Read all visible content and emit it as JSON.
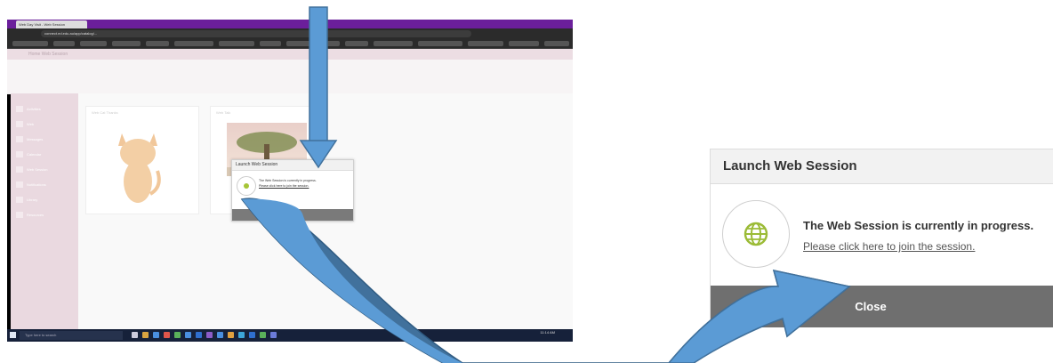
{
  "small_screenshot": {
    "browser_tab": "Web Day Visit - Web Session",
    "url": "connect.ed.edu.au/app/catalog/...",
    "app_bar": "Home    Web Session",
    "nav_items": [
      "Activities",
      "Web",
      "Messages",
      "Calendar",
      "Web Session",
      "Notifications",
      "Library",
      "Resources"
    ],
    "card1_label": "Web Cat Thanks",
    "card2_label": "Web Talk",
    "dialog_title": "Launch Web Session",
    "dialog_message": "The Web Session is currently in progress.",
    "dialog_link": "Please click here to join the session.",
    "taskbar_search": "Type here to search",
    "taskbar_clock": "11:14 AM"
  },
  "dialog": {
    "title": "Launch Web Session",
    "message": "The Web Session is currently in progress.",
    "link": "Please click here to join the session.",
    "close_label": "Close"
  },
  "colors": {
    "arrow_fill": "#5b9bd5",
    "arrow_stroke": "#41719c",
    "footer": "#6f6f6f",
    "globe": "#9bbb36"
  }
}
